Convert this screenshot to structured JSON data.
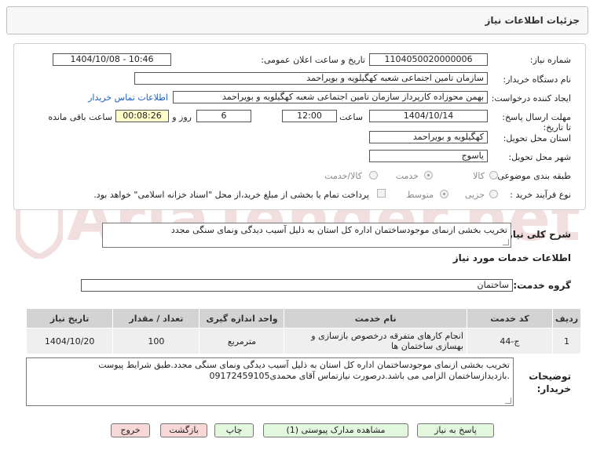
{
  "header": {
    "title": "جزئیات اطلاعات نیاز"
  },
  "watermark": "AriaTender.net",
  "form": {
    "need_number_label": "شماره نیاز:",
    "need_number": "1104050020000006",
    "announce_label": "تاریخ و ساعت اعلان عمومی:",
    "announce_value": "1404/10/08 - 10:46",
    "buyer_org_label": "نام دستگاه خریدار:",
    "buyer_org": "سازمان تامین اجتماعی شعبه کهگیلویه و بویراحمد",
    "creator_label": "ایجاد کننده درخواست:",
    "creator": "بهمن محوزاده کارپرداز سازمان تامین اجتماعی شعبه کهگیلویه و بویراحمد",
    "contact_link": "اطلاعات تماس خریدار",
    "deadline_label": "مهلت ارسال پاسخ: تا تاریخ:",
    "deadline_date": "1404/10/14",
    "time_label": "ساعت",
    "deadline_time": "12:00",
    "days": "6",
    "days_label": "روز و",
    "remaining": "00:08:26",
    "remaining_label": "ساعت باقی مانده",
    "province_label": "استان محل تحویل:",
    "province": "کهگیلویه و بویراحمد",
    "city_label": "شهر محل تحویل:",
    "city": "یاسوج",
    "category_label": "طبقه بندی موضوعی:",
    "category_options": [
      "کالا",
      "خدمت",
      "کالا/خدمت"
    ],
    "category_selected": "خدمت",
    "process_label": "نوع فرآیند خرید :",
    "process_options": [
      "جزیی",
      "متوسط"
    ],
    "process_selected": "متوسط",
    "payment_note": "پرداخت تمام یا بخشی از مبلغ خرید،از محل \"اسناد خزانه اسلامی\" خواهد بود."
  },
  "description": {
    "label": "شرح کلی نیاز:",
    "text": "تخریب بخشی ازنمای موجودساختمان اداره کل استان به ذلیل آسیب دیدگی ونمای سنگی مجدد"
  },
  "services": {
    "section_title": "اطلاعات خدمات مورد نیاز",
    "group_label": "گروه خدمت:",
    "group_value": "ساختمان",
    "columns": [
      "ردیف",
      "کد خدمت",
      "نام خدمت",
      "واحد اندازه گیری",
      "تعداد / مقدار",
      "تاریخ نیاز"
    ],
    "rows": [
      {
        "row": "1",
        "code": "ج-44",
        "name": "انجام کارهای متفرقه درخصوص بازسازی و بهسازی ساختمان ها",
        "unit": "مترمربع",
        "qty": "100",
        "date": "1404/10/20"
      }
    ]
  },
  "buyer_notes": {
    "label": "توضیحات خریدار:",
    "line1": "تخریب بخشی ازنمای موجودساختمان اداره کل استان به ذلیل آسیب دیدگی ونمای سنگی مجدد.طبق شرایط پیوست",
    "line2": ".بازدیدازساختمان الزامی می باشد.درصورت نیازتماس آقای محمدی09172459105"
  },
  "buttons": {
    "reply": "پاسخ به نیاز",
    "attachments": "مشاهده مدارک پیوستی (1)",
    "print": "چاپ",
    "back": "بازگشت",
    "exit": "خروج"
  }
}
